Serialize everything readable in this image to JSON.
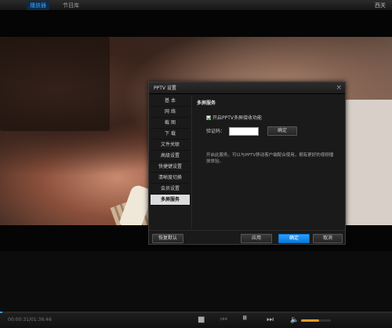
{
  "topbar": {
    "tabs": [
      {
        "label": "播放器",
        "active": true
      },
      {
        "label": "节目库",
        "active": false
      }
    ],
    "right_text": "西关"
  },
  "player": {
    "time": "00:00:31/01:36:46",
    "progress_fraction": 0.0054,
    "volume_fraction": 0.6
  },
  "dialog": {
    "title": "PPTV 设置",
    "close_glyph": "×",
    "nav": [
      {
        "label": "基  本",
        "active": false
      },
      {
        "label": "网  络",
        "active": false
      },
      {
        "label": "截  图",
        "active": false
      },
      {
        "label": "下  载",
        "active": false
      },
      {
        "label": "文件关联",
        "active": false
      },
      {
        "label": "高级设置",
        "active": false
      },
      {
        "label": "快捷键设置",
        "active": false
      },
      {
        "label": "清晰度切换",
        "active": false
      },
      {
        "label": "会员设置",
        "active": false
      },
      {
        "label": "多屏服务",
        "active": true
      }
    ],
    "section_title": "多屏服务",
    "enable_label": "开启PPTV多屏接收功能",
    "enable_checked": true,
    "code_label": "验证码：",
    "code_value": "",
    "confirm_small": "确定",
    "description": "开启此服务，可以与PPTV移动客户端配合使用，拥有更好的视频播放体验。",
    "buttons": {
      "restore": "恢复默认",
      "apply": "应用",
      "ok": "确定",
      "cancel": "取消"
    }
  },
  "colors": {
    "accent": "#1e90ff",
    "volume": "#e89a2a"
  }
}
